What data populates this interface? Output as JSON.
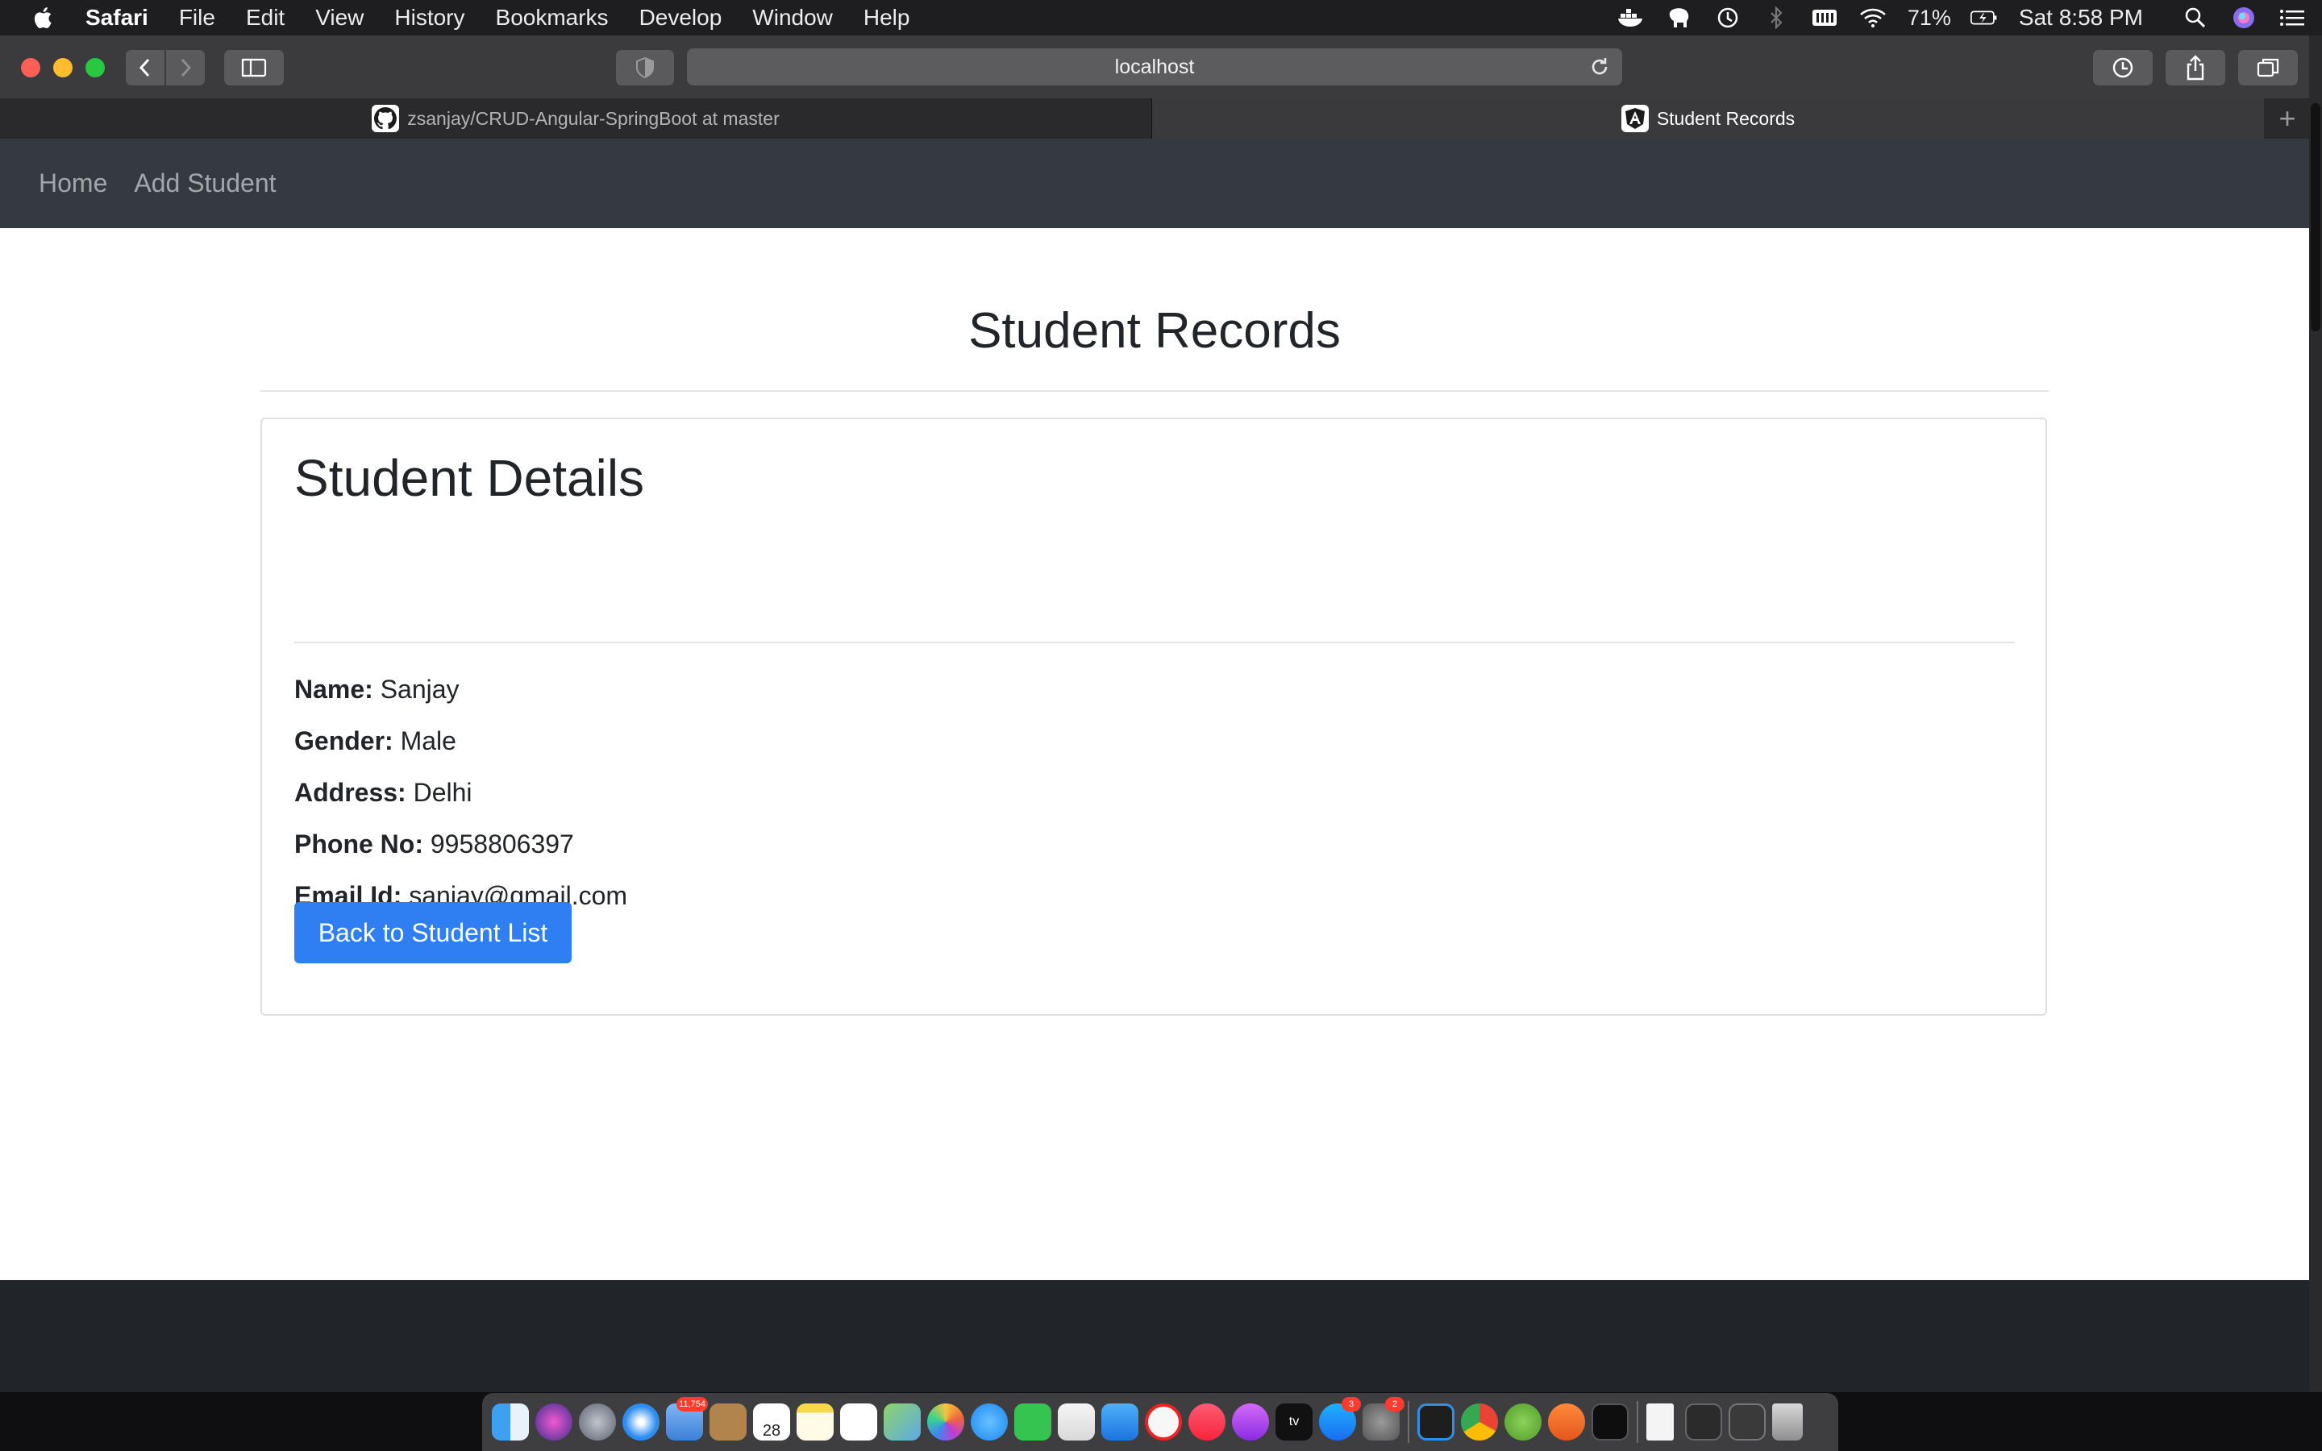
{
  "menubar": {
    "app_name": "Safari",
    "items": [
      "File",
      "Edit",
      "View",
      "History",
      "Bookmarks",
      "Develop",
      "Window",
      "Help"
    ],
    "battery": "71%",
    "clock": "Sat 8:58 PM"
  },
  "browser": {
    "url": "localhost",
    "tabs": [
      {
        "title": "zsanjay/CRUD-Angular-SpringBoot at master",
        "favicon": "github-icon",
        "active": false
      },
      {
        "title": "Student Records",
        "favicon": "angular-icon",
        "active": true
      }
    ]
  },
  "nav": {
    "home": "Home",
    "add_student": "Add Student"
  },
  "page": {
    "title": "Student Records"
  },
  "details": {
    "heading": "Student Details",
    "fields": [
      {
        "label": "Name:",
        "value": "Sanjay"
      },
      {
        "label": "Gender:",
        "value": "Male"
      },
      {
        "label": "Address:",
        "value": "Delhi"
      },
      {
        "label": "Phone No:",
        "value": "9958806397"
      },
      {
        "label": "Email Id:",
        "value": "sanjay@gmail.com"
      }
    ],
    "back_button": "Back to Student List",
    "button_color": "#2f7ff3"
  },
  "dock": {
    "calendar_day": "28",
    "badges": {
      "mail": "11,754",
      "app_store": "3",
      "system_prefs": "2"
    }
  }
}
